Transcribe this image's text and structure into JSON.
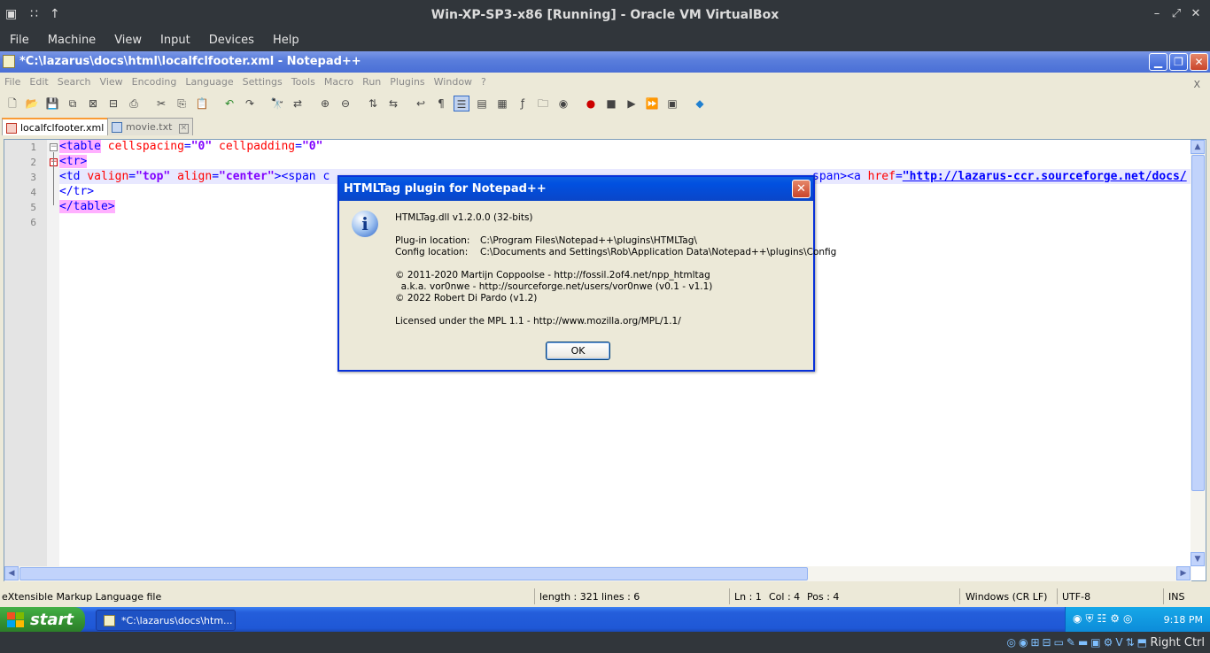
{
  "vbox": {
    "title": "Win-XP-SP3-x86 [Running] - Oracle VM VirtualBox",
    "menu": [
      "File",
      "Machine",
      "View",
      "Input",
      "Devices",
      "Help"
    ],
    "host_key": "Right Ctrl"
  },
  "npp": {
    "title": "*C:\\lazarus\\docs\\html\\localfclfooter.xml - Notepad++",
    "menu": [
      "File",
      "Edit",
      "Search",
      "View",
      "Encoding",
      "Language",
      "Settings",
      "Tools",
      "Macro",
      "Run",
      "Plugins",
      "Window",
      "?"
    ],
    "menu_close": "X",
    "tabs": [
      {
        "label": "localfclfooter.xml",
        "active": true
      },
      {
        "label": "movie.txt",
        "active": false
      }
    ],
    "line_numbers": [
      "1",
      "2",
      "3",
      "4",
      "5",
      "6"
    ],
    "code": {
      "l1_tag": "<table",
      "l1_a1": "cellspacing",
      "l1_v1": "\"0\"",
      "l1_a2": "cellpadding",
      "l1_v2": "\"0\"",
      "l2_tag": "<tr>",
      "l3_tag": "<td",
      "l3_a1": "valign",
      "l3_v1": "\"top\"",
      "l3_a2": "align",
      "l3_v2": "\"center\"",
      "l3_rest": "><span c",
      "l3_right": "span><a",
      "l3_a3": "href",
      "l3_url": "\"http://lazarus-ccr.sourceforge.net/docs/",
      "l4_tag": "</tr>",
      "l5_tag": "</table>"
    },
    "status": {
      "language": "eXtensible Markup Language file",
      "length": "length : 321",
      "lines": "lines : 6",
      "ln": "Ln : 1",
      "col": "Col : 4",
      "pos": "Pos : 4",
      "eol": "Windows (CR LF)",
      "encoding": "UTF-8",
      "mode": "INS"
    }
  },
  "dialog": {
    "title": "HTMLTag plugin for Notepad++",
    "version": "HTMLTag.dll v1.2.0.0 (32-bits)",
    "plugin_location_label": "Plug-in location:",
    "plugin_location": "C:\\Program Files\\Notepad++\\plugins\\HTMLTag\\",
    "config_location_label": "Config location:",
    "config_location": "C:\\Documents and Settings\\Rob\\Application Data\\Notepad++\\plugins\\Config",
    "credit1": "© 2011-2020 Martijn Coppoolse - http://fossil.2of4.net/npp_htmltag",
    "credit2": "  a.k.a. vor0nwe - http://sourceforge.net/users/vor0nwe (v0.1 - v1.1)",
    "credit3": "© 2022 Robert Di Pardo (v1.2)",
    "license": "Licensed under the MPL 1.1 - http://www.mozilla.org/MPL/1.1/",
    "ok_label": "OK"
  },
  "taskbar": {
    "start_label": "start",
    "task_item": "*C:\\lazarus\\docs\\htm...",
    "clock": "9:18 PM"
  }
}
